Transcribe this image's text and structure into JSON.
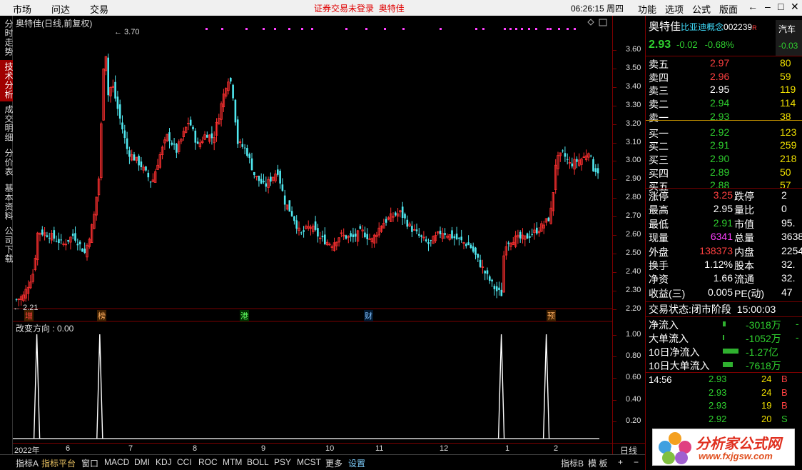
{
  "menubar": {
    "left_items": [
      "市场",
      "问达",
      "交易"
    ],
    "notice": "证券交易未登录",
    "notice_stock": "奥特佳",
    "clock": "06:26:15 周四",
    "right_items": [
      "功能",
      "选项",
      "公式",
      "版面"
    ],
    "window_controls": [
      "←",
      "–",
      "□",
      "✕"
    ]
  },
  "left_tabs": [
    {
      "label": "分时走势",
      "active": false
    },
    {
      "label": "技术分析",
      "active": true
    },
    {
      "label": "成交明细",
      "active": false
    },
    {
      "label": "分价表",
      "active": false
    },
    {
      "label": "基本资料",
      "active": false
    },
    {
      "label": "公司下载",
      "active": false
    }
  ],
  "chart": {
    "title": "奥特佳(日线,前复权)",
    "high_label": "3.70",
    "low_label": "2.21",
    "price_ticks": [
      "3.60",
      "3.50",
      "3.40",
      "3.30",
      "3.20",
      "3.10",
      "3.00",
      "2.90",
      "2.80",
      "2.70",
      "2.60",
      "2.50",
      "2.40",
      "2.30",
      "2.20"
    ],
    "event_labels": [
      "增",
      "榜",
      "港",
      "财",
      "预"
    ],
    "indicator_title": "改变方向 : 0.00",
    "indicator_ticks": [
      "1.00",
      "0.80",
      "0.60",
      "0.40",
      "0.20"
    ],
    "date_labels": [
      "2022年",
      "6",
      "7",
      "8",
      "9",
      "10",
      "11",
      "12",
      "1",
      "2"
    ],
    "period": "日线",
    "colors": {
      "up": "#ff3030",
      "down": "#50e8f0",
      "border": "#7a0000",
      "signal": "#ffffff",
      "marker": "#ff40ff"
    }
  },
  "chart_data": {
    "type": "candlestick",
    "xlabel": "",
    "ylabel": "",
    "price_range": [
      2.2,
      3.7
    ],
    "high": 3.7,
    "low": 2.21,
    "indicator": {
      "name": "改变方向",
      "value": 0.0,
      "range": [
        0,
        1
      ],
      "spike_positions_pct": [
        4,
        14.5,
        81.5,
        89
      ]
    }
  },
  "bottom_tabs": [
    "指标A",
    "指标平台",
    "窗口",
    "MACD",
    "DMI",
    "KDJ",
    "CCI",
    "ROC",
    "MTM",
    "BOLL",
    "PSY",
    "MCST",
    "更多",
    "设置"
  ],
  "bottom_right": [
    "指标B",
    "模",
    "板",
    "+",
    "−"
  ],
  "quote": {
    "name": "奥特佳",
    "concept": "比亚迪概念",
    "code": "002239",
    "tag": "R",
    "sector": "汽车",
    "sector_change": "-0.03",
    "price": "2.93",
    "change": "-0.02",
    "change_pct": "-0.68%",
    "asks": [
      {
        "label": "卖五",
        "price": "2.97",
        "vol": "80"
      },
      {
        "label": "卖四",
        "price": "2.96",
        "vol": "59"
      },
      {
        "label": "卖三",
        "price": "2.95",
        "vol": "119"
      },
      {
        "label": "卖二",
        "price": "2.94",
        "vol": "114"
      },
      {
        "label": "卖一",
        "price": "2.93",
        "vol": "38"
      }
    ],
    "bids": [
      {
        "label": "买一",
        "price": "2.92",
        "vol": "123"
      },
      {
        "label": "买二",
        "price": "2.91",
        "vol": "259"
      },
      {
        "label": "买三",
        "price": "2.90",
        "vol": "218"
      },
      {
        "label": "买四",
        "price": "2.89",
        "vol": "50"
      },
      {
        "label": "买五",
        "price": "2.88",
        "vol": "57"
      }
    ],
    "stats": [
      {
        "l1": "涨停",
        "v1": "3.25",
        "c1": "red",
        "l2": "跌停",
        "v2": "2"
      },
      {
        "l1": "最高",
        "v1": "2.95",
        "c1": "white",
        "l2": "量比",
        "v2": "0"
      },
      {
        "l1": "最低",
        "v1": "2.91",
        "c1": "green",
        "l2": "市值",
        "v2": "95."
      },
      {
        "l1": "现量",
        "v1": "6341",
        "c1": "magenta",
        "l2": "总量",
        "v2": "3638"
      },
      {
        "l1": "外盘",
        "v1": "138373",
        "c1": "red",
        "l2": "内盘",
        "v2": "2254"
      },
      {
        "l1": "换手",
        "v1": "1.12%",
        "c1": "white",
        "l2": "股本",
        "v2": "32."
      },
      {
        "l1": "净资",
        "v1": "1.66",
        "c1": "white",
        "l2": "流通",
        "v2": "32."
      },
      {
        "l1": "收益(三)",
        "v1": "0.005",
        "c1": "white",
        "l2": "PE(动)",
        "v2": "47"
      }
    ],
    "trade_status_label": "交易状态:",
    "trade_status": "闭市阶段",
    "trade_time": "15:00:03",
    "flows": [
      {
        "label": "净流入",
        "value": "-3018万",
        "tail": "-"
      },
      {
        "label": "大单流入",
        "value": "-1052万",
        "tail": "-"
      },
      {
        "label": "10日净流入",
        "value": "-1.27亿",
        "tail": ""
      },
      {
        "label": "10日大单流入",
        "value": "-7618万",
        "tail": ""
      }
    ],
    "ticks": [
      {
        "time": "14:56",
        "price": "2.93",
        "vol": "24",
        "side": "B"
      },
      {
        "time": "",
        "price": "2.93",
        "vol": "24",
        "side": "B"
      },
      {
        "time": "",
        "price": "2.93",
        "vol": "19",
        "side": "B"
      },
      {
        "time": "",
        "price": "2.92",
        "vol": "20",
        "side": "S"
      }
    ]
  },
  "watermark": {
    "title": "分析家公式网",
    "url": "www.fxjgsw.com"
  }
}
